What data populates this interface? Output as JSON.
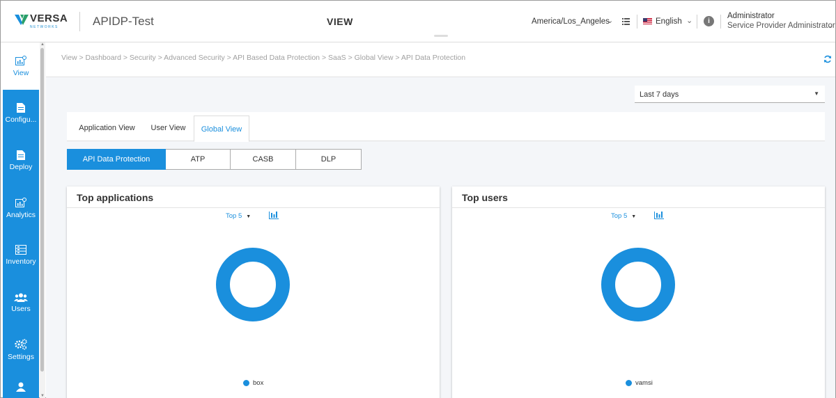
{
  "header": {
    "logo_text": "VERSA",
    "logo_subtext": "NETWORKS",
    "tenant": "APIDP-Test",
    "page_title": "VIEW",
    "timezone": "America/Los_Angeles",
    "language": "English",
    "user_name": "Administrator",
    "user_role": "Service Provider Administrator"
  },
  "sidebar": {
    "items": [
      {
        "label": "View",
        "icon": "view-chart-icon",
        "active": true
      },
      {
        "label": "Configu...",
        "icon": "document-icon",
        "active": false
      },
      {
        "label": "Deploy",
        "icon": "document-icon",
        "active": false
      },
      {
        "label": "Analytics",
        "icon": "analytics-chart-icon",
        "active": false
      },
      {
        "label": "Inventory",
        "icon": "inventory-icon",
        "active": false
      },
      {
        "label": "Users",
        "icon": "users-icon",
        "active": false
      },
      {
        "label": "Settings",
        "icon": "gears-icon",
        "active": false
      }
    ]
  },
  "breadcrumb": "View > Dashboard > Security > Advanced Security > API Based Data Protection > SaaS > Global View > API Data Protection",
  "time_range": "Last 7 days",
  "tabs": [
    "Application View",
    "User View",
    "Global View"
  ],
  "active_tab": "Global View",
  "segments": [
    "API Data Protection",
    "ATP",
    "CASB",
    "DLP"
  ],
  "active_segment": "API Data Protection",
  "accent_color": "#1a8fdd",
  "cards": [
    {
      "title": "Top applications",
      "top_selector": "Top 5",
      "chart_data": {
        "type": "pie",
        "categories": [
          "box"
        ],
        "values": [
          100
        ],
        "colors": [
          "#1a8fdd"
        ],
        "legend": "bottom"
      }
    },
    {
      "title": "Top users",
      "top_selector": "Top 5",
      "chart_data": {
        "type": "pie",
        "categories": [
          "vamsi"
        ],
        "values": [
          100
        ],
        "colors": [
          "#1a8fdd"
        ],
        "legend": "bottom"
      }
    }
  ]
}
